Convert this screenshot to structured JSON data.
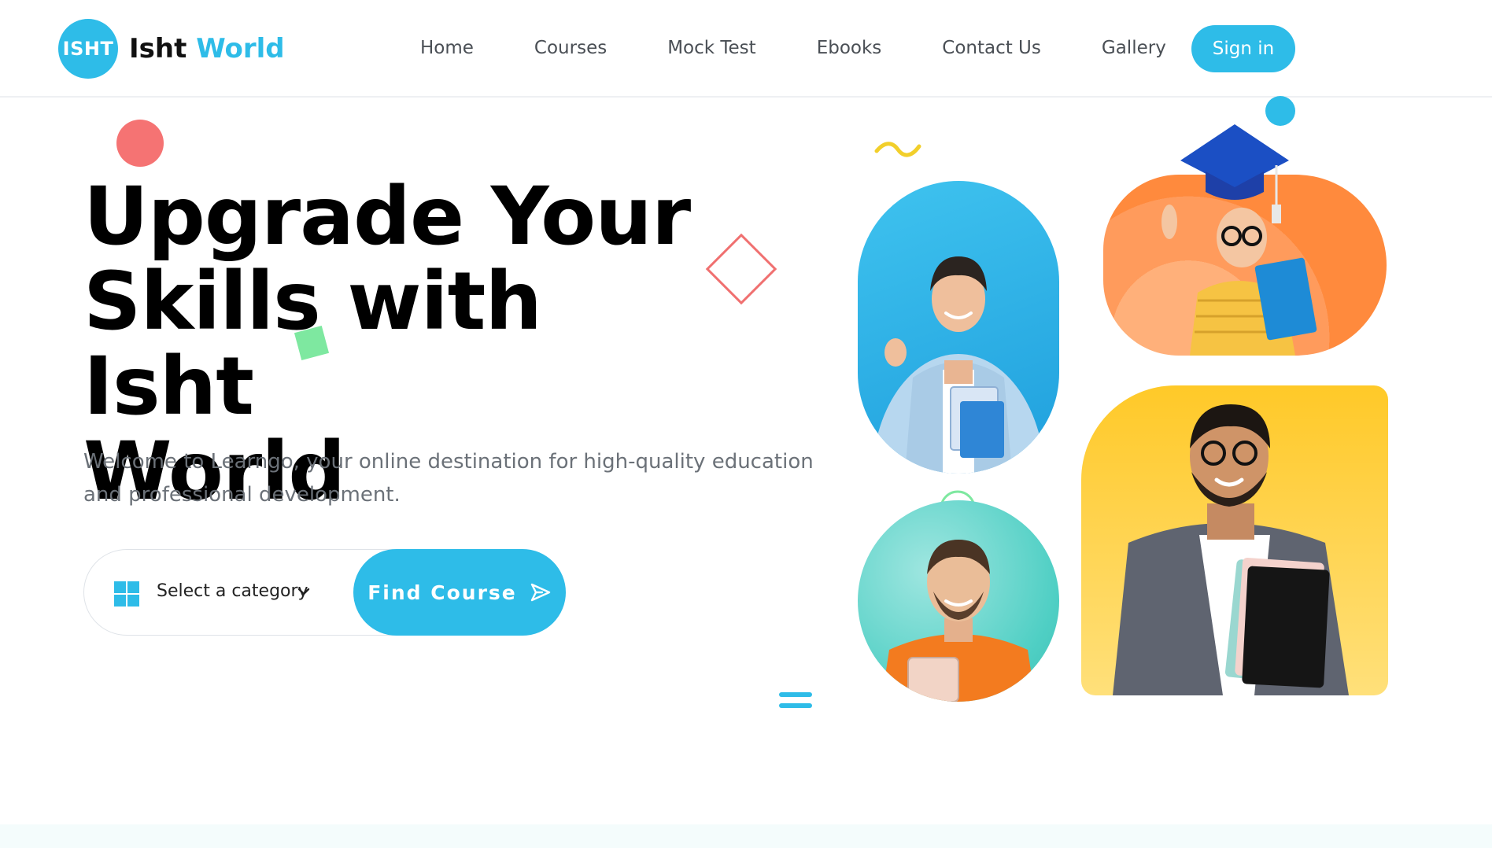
{
  "brand": {
    "badge": "ISHT",
    "name_part1": "Isht",
    "name_part2": "World",
    "accent_color": "#2ebce8"
  },
  "nav": {
    "items": [
      {
        "label": "Home"
      },
      {
        "label": "Courses"
      },
      {
        "label": "Mock Test"
      },
      {
        "label": "Ebooks"
      },
      {
        "label": "Contact Us"
      },
      {
        "label": "Gallery"
      }
    ],
    "signin_label": "Sign in"
  },
  "hero": {
    "title_line1": "Upgrade Your",
    "title_line2": "Skills with Isht",
    "title_line3": "World",
    "subtitle": "Welcome to Learngo, your online destination for high-quality education and professional development."
  },
  "search": {
    "category_placeholder": "Select a category",
    "button_label": "Find Course",
    "category_icon": "grid-icon",
    "button_icon": "send-icon"
  },
  "colors": {
    "primary": "#2ebce8",
    "red_accent": "#f57373",
    "green_accent": "#7ee8a0",
    "yellow_accent": "#f2cf2b"
  }
}
